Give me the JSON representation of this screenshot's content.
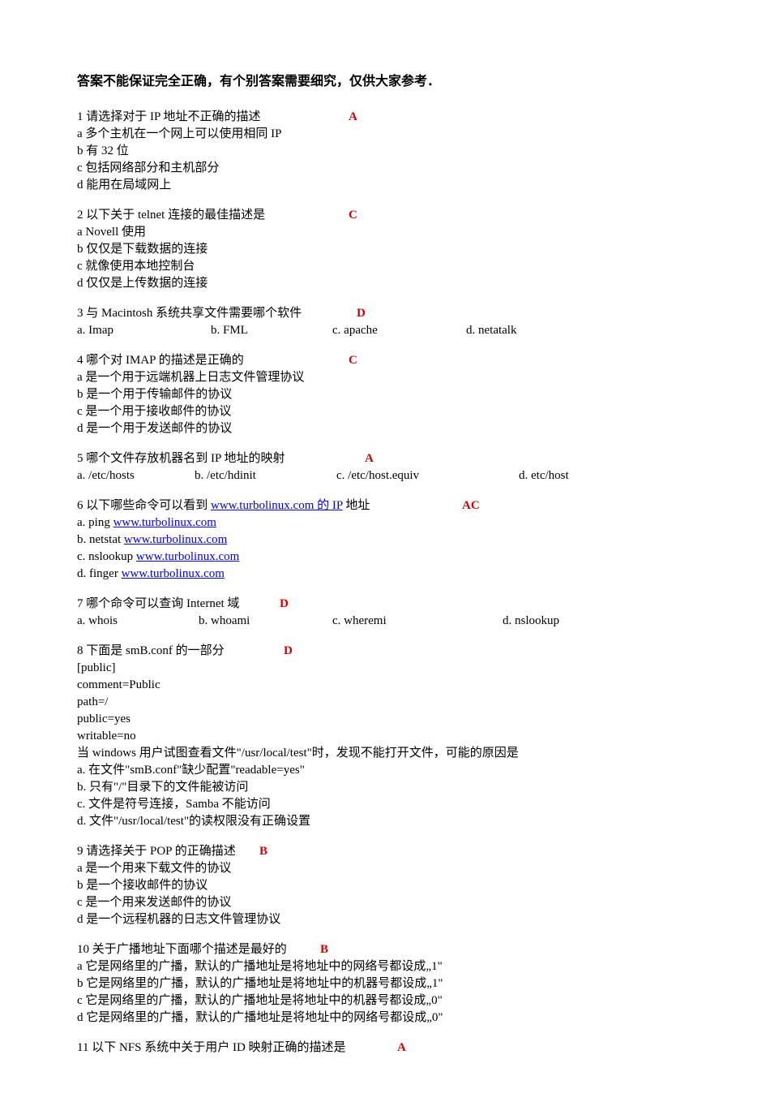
{
  "header": "答案不能保证完全正确，有个别答案需要细究，仅供大家参考．",
  "q1": {
    "title": "1 请选择对于 IP 地址不正确的描述",
    "ans": "A",
    "a": "a 多个主机在一个网上可以使用相同 IP",
    "b": "b 有 32 位",
    "c": "c 包括网络部分和主机部分",
    "d": "d 能用在局域网上"
  },
  "q2": {
    "title": "2 以下关于 telnet 连接的最佳描述是",
    "ans": "C",
    "a": "a  Novell 使用",
    "b": "b 仅仅是下载数据的连接",
    "c": "c 就像使用本地控制台",
    "d": "d 仅仅是上传数据的连接"
  },
  "q3": {
    "title": "3 与 Macintosh 系统共享文件需要哪个软件",
    "ans": "D",
    "a": "a.  Imap",
    "b": "b.  FML",
    "c": "c.  apache",
    "d": "d.  netatalk"
  },
  "q4": {
    "title": "4 哪个对 IMAP 的描述是正确的",
    "ans": "C",
    "a": "a 是一个用于远端机器上日志文件管理协议",
    "b": "b 是一个用于传输邮件的协议",
    "c": "c 是一个用于接收邮件的协议",
    "d": "d  是一个用于发送邮件的协议"
  },
  "q5": {
    "title": "5 哪个文件存放机器名到 IP 地址的映射",
    "ans": "A",
    "a": "a.  /etc/hosts",
    "b": "b.  /etc/hdinit",
    "c": "c.  /etc/host.equiv",
    "d": "d.  etc/host"
  },
  "q6": {
    "title_pre": "6 以下哪些命令可以看到 ",
    "title_link": "www.turbolinux.com 的 IP",
    "title_post": " 地址",
    "ans": "AC",
    "a_pre": "a.  ping  ",
    "a_link": "www.turbolinux.com",
    "b_pre": "b.  netstat  ",
    "b_link": "www.turbolinux.com",
    "c_pre": "c.  nslookup  ",
    "c_link": "www.turbolinux.com",
    "d_pre": "d.  finger    ",
    "d_link": "www.turbolinux.com"
  },
  "q7": {
    "title": "7 哪个命令可以查询 Internet 域",
    "ans": "D",
    "a": "a.  whois",
    "b": "b.  whoami",
    "c": "c.  wheremi",
    "d": "d.  nslookup"
  },
  "q8": {
    "title": "8 下面是 smB.conf 的一部分",
    "ans": "D",
    "l1": "[public]",
    "l2": "comment=Public",
    "l3": "path=/",
    "l4": "public=yes",
    "l5": "writable=no",
    "l6": "当 windows 用户试图查看文件\"/usr/local/test\"时，发现不能打开文件，可能的原因是",
    "a": "a.    在文件\"smB.conf\"缺少配置\"readable=yes\"",
    "b": "b.    只有\"/\"目录下的文件能被访问",
    "c": "c.    文件是符号连接，Samba 不能访问",
    "d": "d.    文件\"/usr/local/test\"的读权限没有正确设置"
  },
  "q9": {
    "title": "9 请选择关于 POP 的正确描述",
    "ans": "B",
    "a": "a 是一个用来下载文件的协议",
    "b": "b 是一个接收邮件的协议",
    "c": "c 是一个用来发送邮件的协议",
    "d": "d 是一个远程机器的日志文件管理协议"
  },
  "q10": {
    "title": "10 关于广播地址下面哪个描述是最好的",
    "ans": "B",
    "a": "a 它是网络里的广播，默认的广播地址是将地址中的网络号都设成„1\"",
    "b": "b 它是网络里的广播，默认的广播地址是将地址中的机器号都设成„1\"",
    "c": "c 它是网络里的广播，默认的广播地址是将地址中的机器号都设成„0\"",
    "d": "d 它是网络里的广播，默认的广播地址是将地址中的网络号都设成„0\""
  },
  "q11": {
    "title": "11 以下 NFS 系统中关于用户 ID 映射正确的描述是",
    "ans": "A"
  }
}
